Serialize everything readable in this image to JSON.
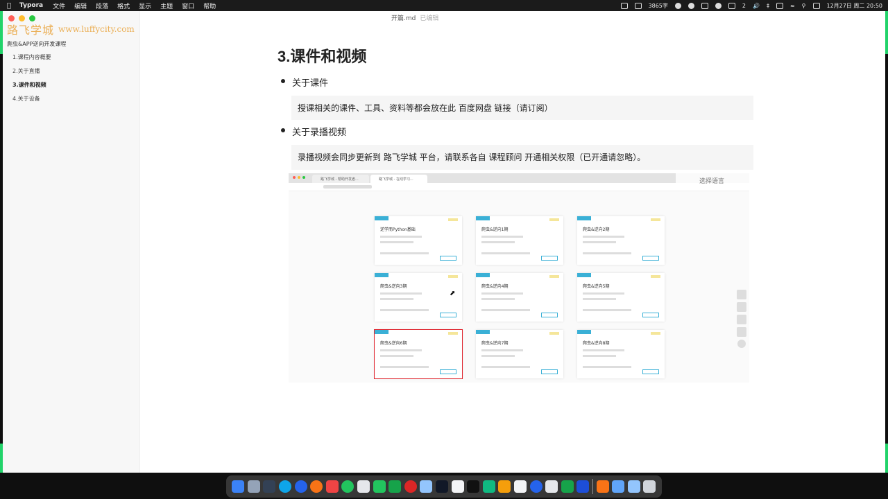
{
  "menubar": {
    "app": "Typora",
    "items": [
      "文件",
      "编辑",
      "段落",
      "格式",
      "显示",
      "主题",
      "窗口",
      "帮助"
    ],
    "status": {
      "words": "3865字",
      "date_time": "12月27日 周二 20:50",
      "badge": "2"
    }
  },
  "window": {
    "file_title": "开篇.md",
    "save_state": "已编辑"
  },
  "watermark": {
    "text1": "路飞学城",
    "text2": "www.luffycity.com"
  },
  "outline": {
    "root": "爬虫&APP逆向开发课程",
    "items": [
      {
        "label": "1.课程内容概要",
        "active": false
      },
      {
        "label": "2.关于直播",
        "active": false
      },
      {
        "label": "3.课件和视频",
        "active": true
      },
      {
        "label": "4.关于设备",
        "active": false
      }
    ]
  },
  "doc": {
    "heading": "3.课件和视频",
    "bullet1": "关于课件",
    "quote1": "授课相关的课件、工具、资料等都会放在此 百度网盘 链接（请订阅）",
    "bullet2": "关于录播视频",
    "quote2": "录播视频会同步更新到 路飞学城 平台，请联系各自 课程顾问 开通相关权限（已开通请忽略）。"
  },
  "embedded": {
    "select_language": "选择语言",
    "tabs": [
      "路飞学城 - 帮助开发者...",
      "路飞学城 - 在线学习..."
    ],
    "cards": [
      {
        "title": "逆学而Python基础"
      },
      {
        "title": "爬虫&逆向1期"
      },
      {
        "title": "爬虫&逆向2期"
      },
      {
        "title": "爬虫&逆向3期"
      },
      {
        "title": "爬虫&逆向4期"
      },
      {
        "title": "爬虫&逆向5期"
      },
      {
        "title": "爬虫&逆向6期"
      },
      {
        "title": "爬虫&逆向7期"
      },
      {
        "title": "爬虫&逆向8期"
      }
    ]
  },
  "colors": {
    "accent_green": "#22d36a",
    "card_tag": "#3ab0d6",
    "selection_red": "#e0262f"
  }
}
